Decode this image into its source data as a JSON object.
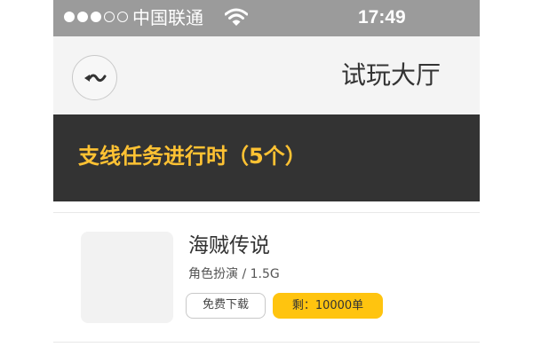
{
  "status_bar": {
    "carrier": "中国联通",
    "time": "17:49",
    "signal_dots_filled": 3,
    "signal_dots_total": 5,
    "wifi_icon": "wifi-icon"
  },
  "nav": {
    "back_icon": "back-wave-icon",
    "title": "试玩大厅"
  },
  "banner": {
    "text": "支线任务进行时（5个）"
  },
  "games": [
    {
      "name": "海贼传说",
      "meta": "角色扮演 / 1.5G",
      "download_label": "免费下载",
      "remaining_label": "剩：10000单"
    }
  ],
  "colors": {
    "status_bar_bg": "#9b9b9b",
    "nav_bg": "#f4f4f4",
    "banner_bg": "#333333",
    "banner_text": "#ffc233",
    "badge_bg": "#ffc40f"
  }
}
